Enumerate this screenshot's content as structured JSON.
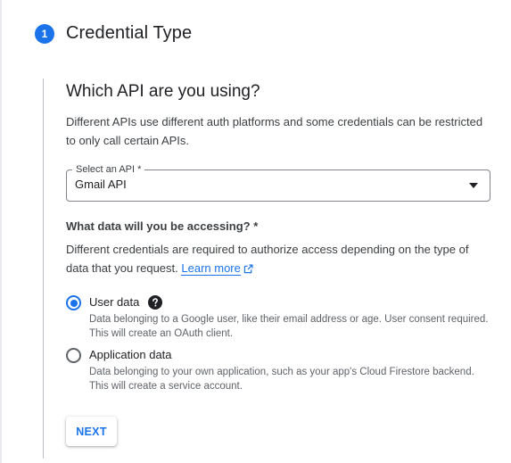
{
  "step": {
    "number": "1",
    "title": "Credential Type"
  },
  "api_section": {
    "heading": "Which API are you using?",
    "description": "Different APIs use different auth platforms and some credentials can be restricted to only call certain APIs.",
    "select": {
      "label": "Select an API *",
      "value": "Gmail API"
    }
  },
  "data_section": {
    "heading": "What data will you be accessing? *",
    "description": "Different credentials are required to authorize access depending on the type of data that you request.",
    "learn_more": "Learn more",
    "options": [
      {
        "label": "User data",
        "description": "Data belonging to a Google user, like their email address or age. User consent required. This will create an OAuth client.",
        "selected": true
      },
      {
        "label": "Application data",
        "description": "Data belonging to your own application, such as your app's Cloud Firestore backend. This will create a service account.",
        "selected": false
      }
    ]
  },
  "actions": {
    "next_label": "NEXT"
  },
  "colors": {
    "accent": "#1a73e8",
    "text": "#202124",
    "secondary_text": "#5f6368"
  }
}
